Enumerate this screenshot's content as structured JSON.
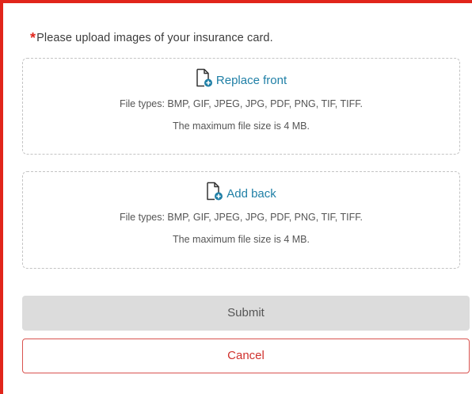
{
  "form": {
    "required_marker": "*",
    "prompt": "Please upload images of your insurance card."
  },
  "front_upload": {
    "icon": "file-add-icon",
    "action_label": "Replace front",
    "file_types": "File types: BMP, GIF, JPEG, JPG, PDF, PNG, TIF, TIFF.",
    "max_size": "The maximum file size is 4 MB."
  },
  "back_upload": {
    "icon": "file-add-icon",
    "action_label": "Add back",
    "file_types": "File types: BMP, GIF, JPEG, JPG, PDF, PNG, TIF, TIFF.",
    "max_size": "The maximum file size is 4 MB."
  },
  "buttons": {
    "submit_label": "Submit",
    "cancel_label": "Cancel"
  },
  "colors": {
    "accent_red": "#e1251b",
    "link_blue": "#1f7fa6",
    "disabled_gray": "#dcdcdc"
  }
}
